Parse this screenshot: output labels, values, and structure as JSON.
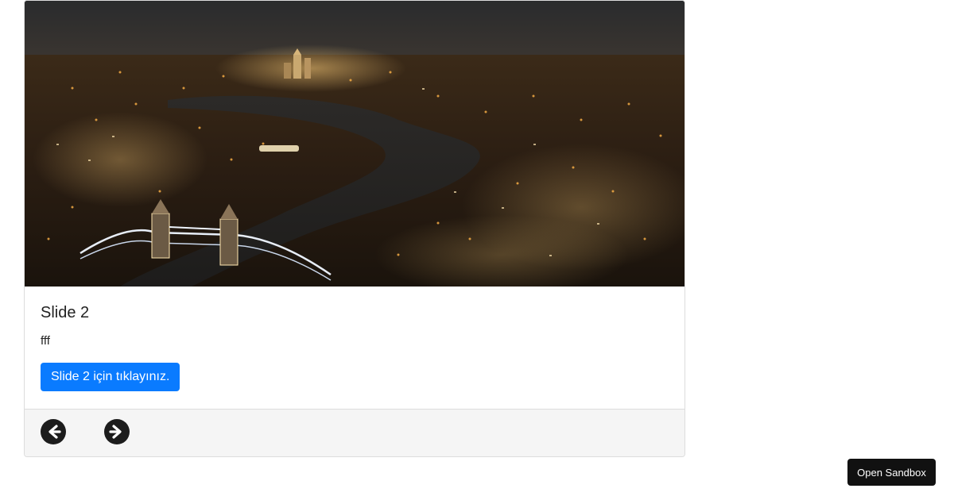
{
  "slide": {
    "title": "Slide 2",
    "text": "fff",
    "button_label": "Slide 2 için tıklayınız.",
    "image_alt": "London skyline at night with Tower Bridge and the River Thames"
  },
  "nav": {
    "prev_icon": "arrow-left-circle-icon",
    "next_icon": "arrow-right-circle-icon"
  },
  "sandbox": {
    "label": "Open Sandbox"
  },
  "colors": {
    "primary": "#0a7bff",
    "footer_bg": "#f5f5f5",
    "sandbox_bg": "#111111"
  }
}
